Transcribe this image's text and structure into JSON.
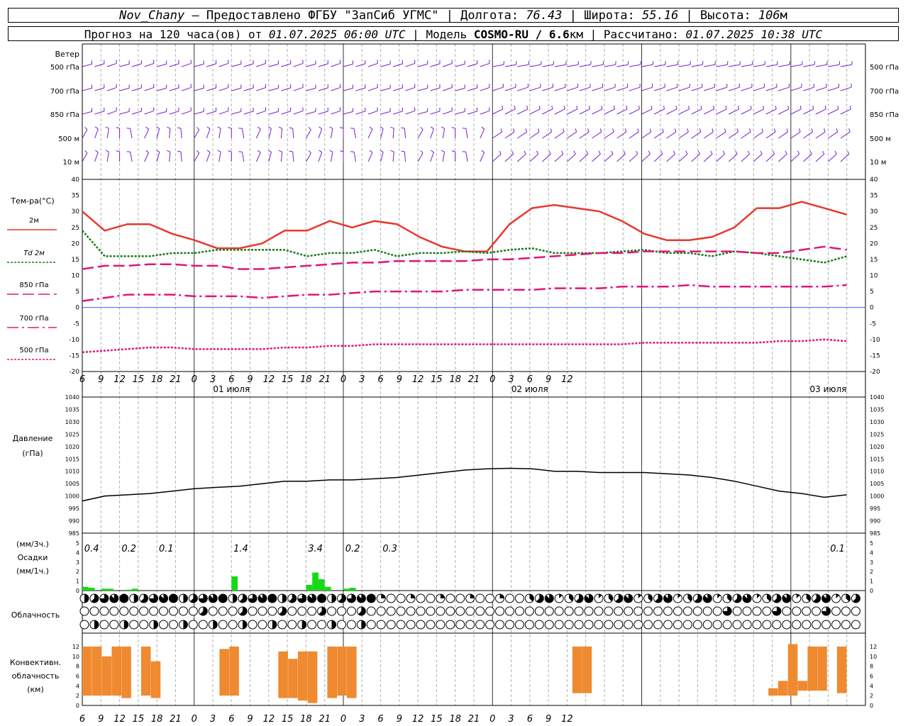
{
  "header": {
    "station": "Nov_Chany",
    "provider": "– Предоставлено ФГБУ \"ЗапСиб УГМС\"",
    "lon_label": "Долгота:",
    "lon": "76.43",
    "lat_label": "Широта:",
    "lat": "55.16",
    "alt_label": "Высота:",
    "alt": "106",
    "alt_unit": "м",
    "forecast_label": "Прогноз на 120 часа(ов) от",
    "forecast_from": "01.07.2025 06:00 UTC",
    "model_label": "Модель",
    "model": "COSMO-RU / 6.6",
    "model_unit": "км",
    "calc_label": "Рассчитано:",
    "calc_time": "01.07.2025 10:38 UTC"
  },
  "chart_data": [
    {
      "type": "barbs",
      "panel": "wind",
      "title": "Ветер",
      "levels": [
        "500 гПа",
        "700 гПа",
        "850 гПа",
        "500 м",
        "10  м"
      ],
      "color": "#7a1ec8"
    },
    {
      "type": "line",
      "panel": "temperature",
      "ylabel": "Тем-ра(°C)",
      "ylim": [
        -20,
        40
      ],
      "yticks": [
        -20,
        -15,
        -10,
        -5,
        0,
        5,
        10,
        15,
        20,
        25,
        30,
        35,
        40
      ],
      "x_tick_labels": [
        "6",
        "9",
        "12",
        "15",
        "18",
        "21",
        "0",
        "3",
        "6",
        "9",
        "12",
        "15",
        "18",
        "21",
        "0",
        "3",
        "6",
        "9",
        "12",
        "15",
        "18",
        "21",
        "0",
        "3",
        "6",
        "9",
        "12"
      ],
      "date_labels": [
        "01 июля",
        "02 июля",
        "03 июля"
      ],
      "x_hours": [
        0,
        3,
        6,
        9,
        12,
        15,
        18,
        21,
        24,
        27,
        30,
        33,
        36,
        39,
        42,
        45,
        48,
        51,
        54,
        57,
        60,
        63,
        66,
        69,
        72,
        75,
        78
      ],
      "series": [
        {
          "name": "2м",
          "color": "#e8382e",
          "style": "solid",
          "values": [
            30,
            24,
            26,
            26,
            23,
            21,
            18.5,
            18.5,
            20,
            24,
            24,
            27,
            25,
            27,
            26,
            22,
            19,
            17.5,
            17.5,
            26,
            31,
            32,
            31,
            30,
            27,
            23,
            21,
            21,
            22,
            25,
            31,
            31,
            33,
            31,
            29
          ]
        },
        {
          "name": "Td  2м",
          "color": "#1a7a1a",
          "style": "dotted",
          "values": [
            24,
            16,
            16,
            16,
            17,
            17,
            18,
            18,
            18,
            18,
            16,
            17,
            17,
            18,
            16,
            17,
            17,
            17.5,
            17,
            18,
            18.5,
            17,
            17,
            17,
            17.5,
            18,
            17,
            17,
            16,
            17.5,
            17,
            16,
            15,
            14,
            16
          ]
        },
        {
          "name": "850 гПа",
          "color": "#e0157a",
          "style": "longdash",
          "values": [
            12,
            13,
            13,
            13.5,
            13.5,
            13,
            13,
            12,
            12,
            12.5,
            13,
            13.5,
            14,
            14,
            14.5,
            14.5,
            14.5,
            14.5,
            15,
            15,
            15.5,
            16,
            16.5,
            17,
            17,
            17.5,
            17.5,
            17.5,
            17.5,
            17.5,
            17,
            17,
            18,
            19,
            18
          ]
        },
        {
          "name": "700 гПа",
          "color": "#e0157a",
          "style": "dashdot",
          "values": [
            2,
            3,
            4,
            4,
            4,
            3.5,
            3.5,
            3.5,
            3,
            3.5,
            4,
            4,
            4.5,
            5,
            5,
            5,
            5,
            5.5,
            5.5,
            5.5,
            5.5,
            6,
            6,
            6,
            6.5,
            6.5,
            6.5,
            7,
            6.5,
            6.5,
            6.5,
            6.5,
            6.5,
            6.5,
            7
          ]
        },
        {
          "name": "500 гПа",
          "color": "#e0157a",
          "style": "dotted",
          "values": [
            -14,
            -13.5,
            -13,
            -12.5,
            -12.5,
            -13,
            -13,
            -13,
            -13,
            -12.5,
            -12.5,
            -12,
            -12,
            -11.5,
            -11.5,
            -11.5,
            -11.5,
            -11.5,
            -11.5,
            -11.5,
            -11.5,
            -11.5,
            -11.5,
            -11.5,
            -11.5,
            -11,
            -11,
            -11,
            -11,
            -11,
            -11,
            -10.5,
            -10.5,
            -10,
            -10.5
          ]
        }
      ]
    },
    {
      "type": "line",
      "panel": "pressure",
      "ylabel": "Давление",
      "ylabel2": "(гПа)",
      "ylim": [
        985,
        1040
      ],
      "yticks": [
        985,
        990,
        995,
        1000,
        1005,
        1010,
        1015,
        1020,
        1025,
        1030,
        1035,
        1040
      ],
      "series": [
        {
          "name": "Давление",
          "color": "#000000",
          "values": [
            998,
            1000,
            1000.5,
            1001,
            1002,
            1003,
            1003.5,
            1004,
            1005,
            1006,
            1006,
            1006.5,
            1006.5,
            1007,
            1007.5,
            1008.5,
            1009.5,
            1010.5,
            1011,
            1011.2,
            1011,
            1010,
            1010,
            1009.5,
            1009.5,
            1009.5,
            1009,
            1008.5,
            1007.5,
            1006,
            1004,
            1002,
            1001,
            999.5,
            1000.5
          ]
        }
      ]
    },
    {
      "type": "bar",
      "panel": "precipitation",
      "ylabel": "Осадки",
      "unit_3h": "(мм/3ч.)",
      "unit_1h": "(мм/1ч.)",
      "ylim": [
        0,
        5
      ],
      "yticks": [
        0,
        1,
        2,
        3,
        4,
        5
      ],
      "color": "#16d916",
      "totals_3h": [
        {
          "hour": 1.5,
          "label": "0.4"
        },
        {
          "hour": 7.5,
          "label": "0.2"
        },
        {
          "hour": 13.5,
          "label": "0.1"
        },
        {
          "hour": 25.5,
          "label": "1.4"
        },
        {
          "hour": 37.5,
          "label": "3.4"
        },
        {
          "hour": 43.5,
          "label": "0.2"
        },
        {
          "hour": 49.5,
          "label": "0.3"
        },
        {
          "hour": 121.5,
          "label": "0.1"
        }
      ],
      "hourly": [
        [
          0,
          0.4
        ],
        [
          1,
          0.3
        ],
        [
          3,
          0.2
        ],
        [
          4,
          0.2
        ],
        [
          7,
          0.1
        ],
        [
          8,
          0.2
        ],
        [
          24,
          1.5
        ],
        [
          36,
          0.6
        ],
        [
          37,
          1.9
        ],
        [
          38,
          1.2
        ],
        [
          39,
          0.4
        ],
        [
          42,
          0.2
        ],
        [
          43,
          0.3
        ]
      ]
    },
    {
      "type": "table",
      "panel": "cloudiness",
      "title": "Облачность",
      "rows": [
        "upper",
        "middle",
        "lower"
      ]
    },
    {
      "type": "bar",
      "panel": "convective",
      "ylabel": [
        "Конвективн.",
        "облачность",
        "(км)"
      ],
      "ylim": [
        0,
        13
      ],
      "yticks": [
        0,
        2,
        4,
        6,
        8,
        10,
        12
      ],
      "color": "#ef8a31",
      "bars": [
        [
          0,
          2,
          12
        ],
        [
          1,
          2,
          12
        ],
        [
          2,
          2,
          10
        ],
        [
          3,
          2,
          12
        ],
        [
          4,
          1.5,
          12
        ],
        [
          6,
          2,
          12
        ],
        [
          7,
          1.5,
          9
        ],
        [
          14,
          2,
          11.5
        ],
        [
          15,
          2,
          12
        ],
        [
          16,
          4,
          4
        ],
        [
          20,
          1.5,
          11
        ],
        [
          21,
          1.5,
          9.5
        ],
        [
          22,
          1,
          11
        ],
        [
          23,
          0.5,
          11
        ],
        [
          25,
          1.5,
          12
        ],
        [
          26,
          2,
          12
        ],
        [
          27,
          1.5,
          12
        ],
        [
          50,
          2.5,
          12
        ],
        [
          51,
          2.5,
          12
        ],
        [
          70,
          2,
          3.5
        ],
        [
          71,
          2,
          5
        ],
        [
          72,
          2,
          12.5
        ],
        [
          73,
          3,
          5
        ],
        [
          74,
          3,
          12
        ],
        [
          75,
          3,
          12
        ],
        [
          77,
          2.5,
          12
        ]
      ]
    }
  ]
}
